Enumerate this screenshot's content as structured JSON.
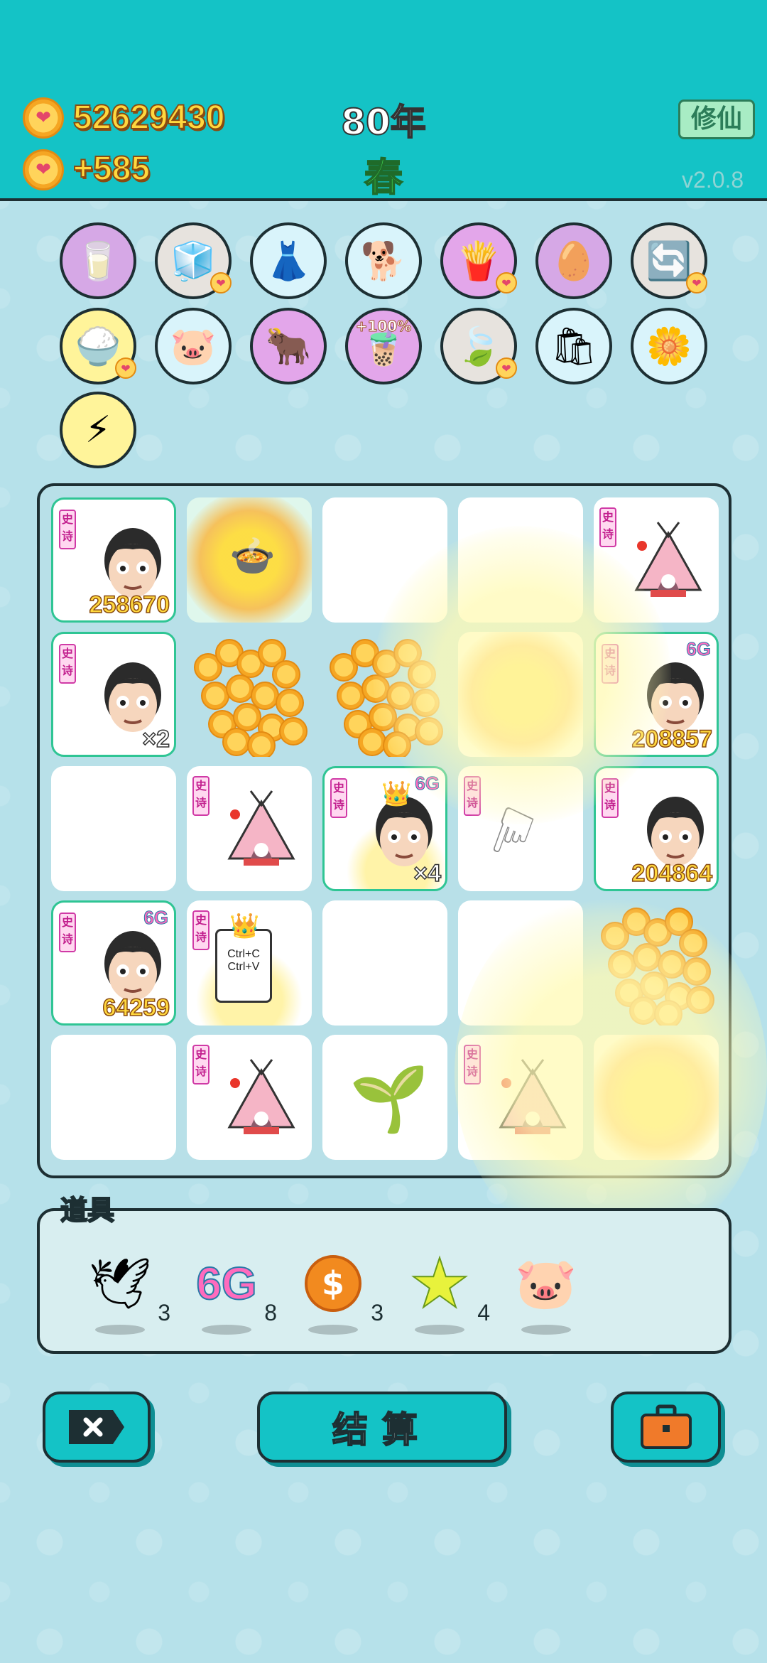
{
  "header": {
    "coins_total": "52629430",
    "coins_rate": "+585",
    "year": "80年",
    "season": "春",
    "cultivate_label": "修仙",
    "version": "v2.0.8"
  },
  "buffs": [
    {
      "name": "milk-jar-icon",
      "glyph": "🥛",
      "bg": "#d6a8e6"
    },
    {
      "name": "sugar-cubes-icon",
      "glyph": "🧊",
      "bg": "#e7e3de"
    },
    {
      "name": "skirt-icon",
      "glyph": "👗",
      "bg": "#d9f4fb"
    },
    {
      "name": "shiba-dog-icon",
      "glyph": "🐕",
      "bg": "#d9f4fb"
    },
    {
      "name": "fries-icon",
      "glyph": "🍟",
      "bg": "#e3a6ea"
    },
    {
      "name": "eyepatch-egg-icon",
      "glyph": "🥚",
      "bg": "#d6a8e6"
    },
    {
      "name": "refresh-icon",
      "glyph": "🔄",
      "bg": "#e7e3de"
    },
    {
      "name": "rice-bowl-icon",
      "glyph": "🍚",
      "bg": "#fff49a"
    },
    {
      "name": "piggy-bank-icon",
      "glyph": "🐷",
      "bg": "#d9f4fb"
    },
    {
      "name": "ox-card-icon",
      "glyph": "🐂",
      "bg": "#e3a6ea"
    },
    {
      "name": "bubble-tea-icon",
      "glyph": "🧋",
      "bg": "#e3a6ea",
      "label": "+100%"
    },
    {
      "name": "leaf-icon",
      "glyph": "🍃",
      "bg": "#e7e3de"
    },
    {
      "name": "trash-bag-icon",
      "glyph": "🛍",
      "bg": "#d9f4fb"
    },
    {
      "name": "flower-pot-icon",
      "glyph": "🌼",
      "bg": "#d9f4fb"
    },
    {
      "name": "lightning-icon",
      "glyph": "⚡",
      "bg": "#fff49a"
    }
  ],
  "board": {
    "tag_label": "史诗",
    "cells": [
      {
        "type": "face",
        "epic": true,
        "tag": true,
        "value": "258670"
      },
      {
        "type": "pot-explosion"
      },
      {
        "type": "empty"
      },
      {
        "type": "empty"
      },
      {
        "type": "tent",
        "tag": true
      },
      {
        "type": "face",
        "epic": true,
        "tag": true,
        "mult": "×2"
      },
      {
        "type": "coins"
      },
      {
        "type": "coins"
      },
      {
        "type": "explosion"
      },
      {
        "type": "face",
        "epic": true,
        "tag": true,
        "sixg": "6G",
        "value": "208857"
      },
      {
        "type": "empty"
      },
      {
        "type": "tent",
        "tag": true
      },
      {
        "type": "face-crown",
        "epic": true,
        "tag": true,
        "sixg": "6G",
        "mult": "×4"
      },
      {
        "type": "pointer",
        "tag": true
      },
      {
        "type": "face",
        "epic": true,
        "tag": true,
        "value": "204864"
      },
      {
        "type": "face",
        "epic": true,
        "tag": true,
        "sixg": "6G",
        "value": "64259"
      },
      {
        "type": "ctrl-card",
        "tag": true,
        "line1": "Ctrl+C",
        "line2": "Ctrl+V"
      },
      {
        "type": "empty"
      },
      {
        "type": "empty"
      },
      {
        "type": "coins"
      },
      {
        "type": "empty"
      },
      {
        "type": "tent",
        "tag": true
      },
      {
        "type": "sprout"
      },
      {
        "type": "tent",
        "tag": true
      },
      {
        "type": "explosion"
      }
    ]
  },
  "tools": {
    "title": "道具",
    "items": [
      {
        "name": "dove-icon",
        "glyph": "🕊",
        "count": "3"
      },
      {
        "name": "sixg-icon",
        "glyph": "6G",
        "count": "8"
      },
      {
        "name": "dollar-coin-icon",
        "glyph": "$",
        "count": "3"
      },
      {
        "name": "star-icon",
        "glyph": "★",
        "count": "4"
      },
      {
        "name": "piggy-bank-icon",
        "glyph": "🐷",
        "count": ""
      }
    ]
  },
  "actions": {
    "settle_label": "结算"
  }
}
